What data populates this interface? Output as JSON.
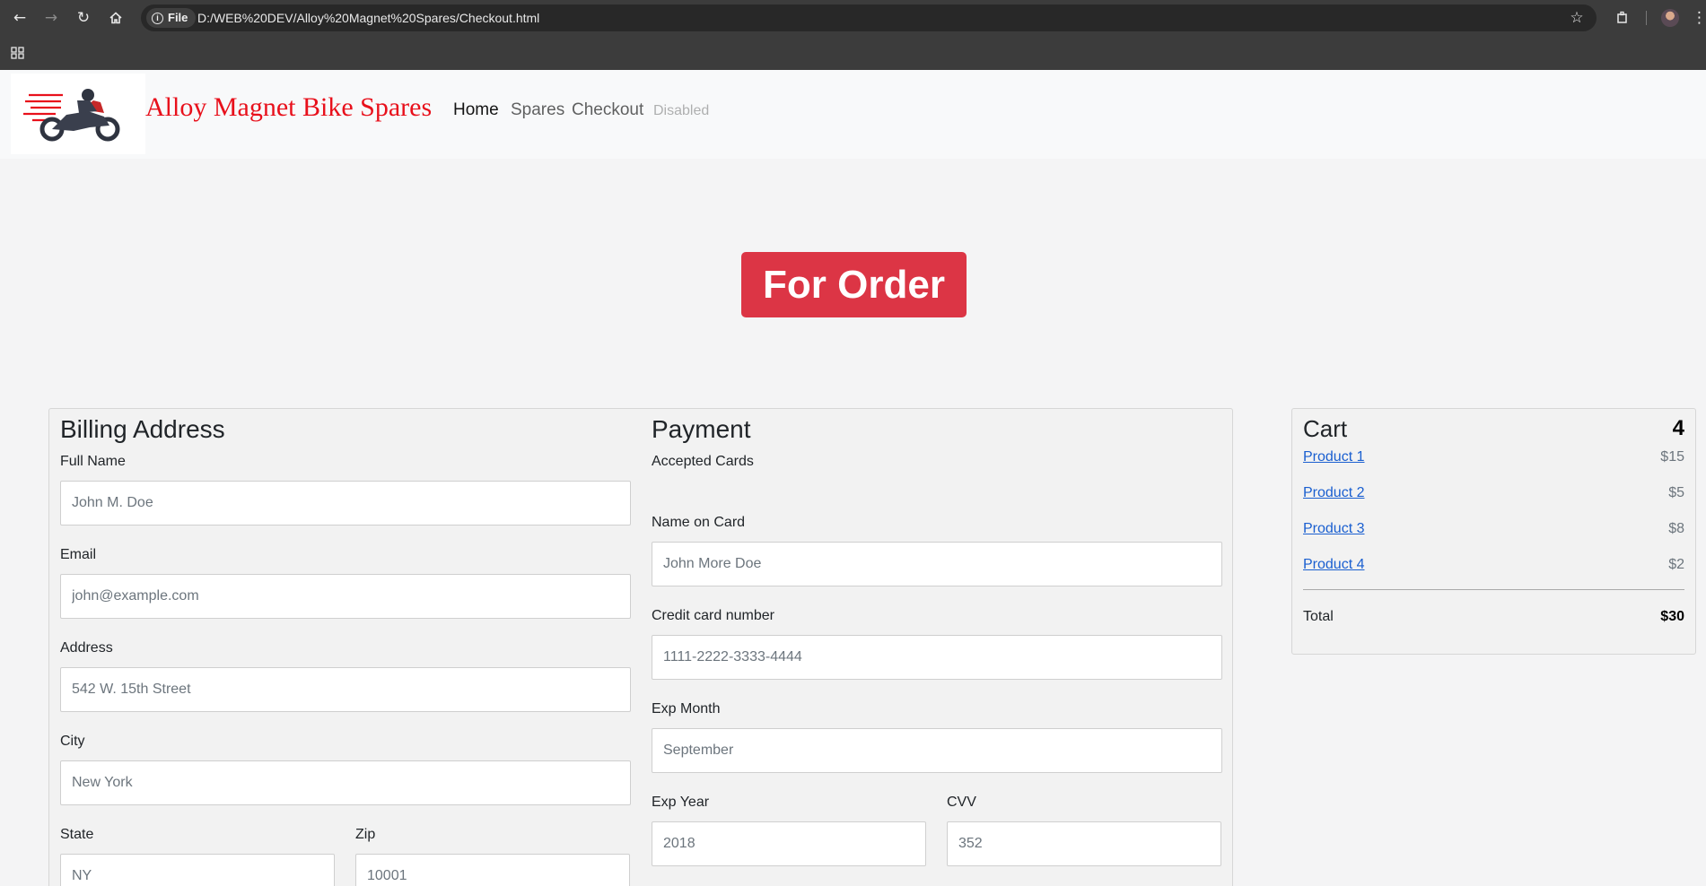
{
  "browser": {
    "file_chip": "File",
    "url": "D:/WEB%20DEV/Alloy%20Magnet%20Spares/Checkout.html"
  },
  "navbar": {
    "brand": "Alloy Magnet Bike Spares",
    "links": [
      {
        "label": "Home",
        "state": "active"
      },
      {
        "label": "Spares",
        "state": "normal"
      },
      {
        "label": "Checkout",
        "state": "normal"
      },
      {
        "label": "Disabled",
        "state": "disabled"
      }
    ]
  },
  "order_button": "For Order",
  "billing": {
    "title": "Billing Address",
    "full_name": {
      "label": "Full Name",
      "placeholder": "John M. Doe"
    },
    "email": {
      "label": "Email",
      "placeholder": "john@example.com"
    },
    "address": {
      "label": "Address",
      "placeholder": "542 W. 15th Street"
    },
    "city": {
      "label": "City",
      "placeholder": "New York"
    },
    "state": {
      "label": "State",
      "placeholder": "NY"
    },
    "zip": {
      "label": "Zip",
      "placeholder": "10001"
    }
  },
  "payment": {
    "title": "Payment",
    "accepted_cards": "Accepted Cards",
    "name_on_card": {
      "label": "Name on Card",
      "placeholder": "John More Doe"
    },
    "card_number": {
      "label": "Credit card number",
      "placeholder": "1111-2222-3333-4444"
    },
    "exp_month": {
      "label": "Exp Month",
      "placeholder": "September"
    },
    "exp_year": {
      "label": "Exp Year",
      "placeholder": "2018"
    },
    "cvv": {
      "label": "CVV",
      "placeholder": "352"
    }
  },
  "cart": {
    "title": "Cart",
    "count": "4",
    "items": [
      {
        "name": "Product 1",
        "price": "$15"
      },
      {
        "name": "Product 2",
        "price": "$5"
      },
      {
        "name": "Product 3",
        "price": "$8"
      },
      {
        "name": "Product 4",
        "price": "$2"
      }
    ],
    "total_label": "Total",
    "total_value": "$30"
  },
  "colors": {
    "brand_red": "#e8101b",
    "order_button": "#dc3545",
    "link_blue": "#1a5fd0"
  },
  "icons": [
    "back-arrow-icon",
    "forward-arrow-icon",
    "reload-icon",
    "home-icon",
    "info-icon",
    "star-icon",
    "extensions-icon",
    "profile-avatar",
    "menu-dots-icon",
    "apps-grid-icon",
    "motorcycle-logo"
  ]
}
